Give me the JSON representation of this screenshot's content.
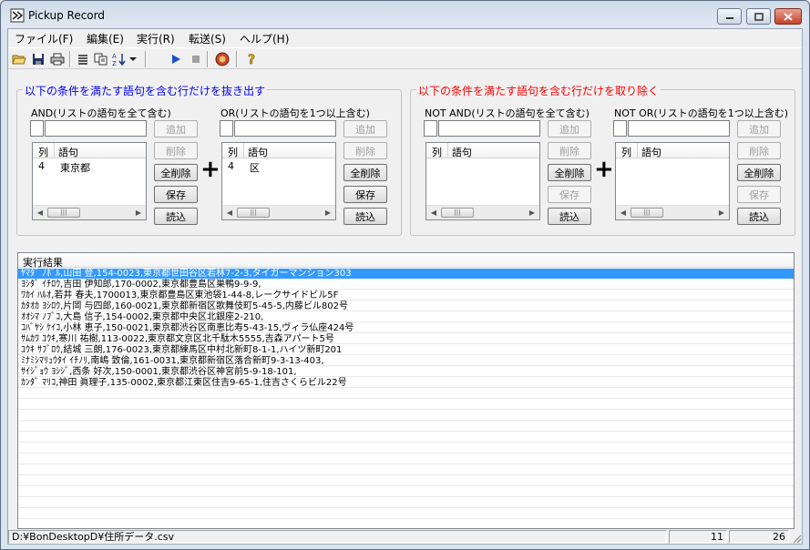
{
  "window": {
    "title": "Pickup Record"
  },
  "menu": [
    "ファイル(F)",
    "編集(E)",
    "実行(R)",
    "転送(S)",
    "ヘルプ(H)"
  ],
  "toolbar": {
    "icons": [
      "open-icon",
      "save-icon",
      "print-icon",
      "list-icon",
      "copy-icon",
      "sort-icon",
      "dropdown-icon",
      "run-icon",
      "stop-icon",
      "transfer-icon",
      "help-icon"
    ]
  },
  "extract_group": {
    "title": "以下の条件を満たす語句を含む行だけを抜き出す",
    "color": "#0000ff",
    "and_list": {
      "label": "AND(リストの語句を全て含む)",
      "column_headers": [
        "列",
        "語句"
      ],
      "rows": [
        {
          "col": "4",
          "term": "東京都"
        }
      ],
      "buttons": {
        "add": "追加",
        "delete": "削除",
        "delete_all": "全削除",
        "save": "保存",
        "load": "読込"
      }
    },
    "or_list": {
      "label": "OR(リストの語句を1つ以上含む)",
      "column_headers": [
        "列",
        "語句"
      ],
      "rows": [
        {
          "col": "4",
          "term": "区"
        }
      ],
      "buttons": {
        "add": "追加",
        "delete": "削除",
        "delete_all": "全削除",
        "save": "保存",
        "load": "読込"
      }
    },
    "plus": "+"
  },
  "exclude_group": {
    "title": "以下の条件を満たす語句を含む行だけを取り除く",
    "color": "#ff0000",
    "not_and_list": {
      "label": "NOT AND(リストの語句を全て含む)",
      "column_headers": [
        "列",
        "語句"
      ],
      "rows": [],
      "buttons": {
        "add": "追加",
        "delete": "削除",
        "delete_all": "全削除",
        "save": "保存",
        "load": "読込"
      }
    },
    "not_or_list": {
      "label": "NOT OR(リストの語句を1つ以上含む)",
      "column_headers": [
        "列",
        "語句"
      ],
      "rows": [],
      "buttons": {
        "add": "追加",
        "delete": "削除",
        "delete_all": "全削除",
        "save": "保存",
        "load": "読込"
      }
    },
    "plus": "+"
  },
  "results": {
    "header": "実行結果",
    "rows": [
      "ﾔﾏﾀﾞ ﾉﾎﾞﾙ,山田 登,154-0023,東京都世田谷区若林7-2-3,タイガーマンション303",
      "ﾖｼﾀﾞ ｲﾁﾛｳ,吉田 伊知郎,170-0002,東京都豊島区巣鴨9-9-9,",
      "ﾜｶｲ ﾊﾙｵ,若井 春夫,1700013,東京都豊島区東池袋1-44-8,レークサイドビル5F",
      "ｶﾀｵｶ ﾖｼﾛｳ,片岡 与四郎,160-0021,東京都新宿区歌舞伎町5-45-5,内藤ビル802号",
      "ｵｵｼﾏ ﾉﾌﾞｺ,大島 信子,154-0002,東京都中央区北銀座2-210,",
      "ｺﾊﾞﾔｼ ｹｲｺ,小林 恵子,150-0021,東京都渋谷区南恵比寿5-43-15,ヴィラ仏座424号",
      "ｻﾑｶﾜ ﾕｳｷ,寒川 祐樹,113-0022,東京都文京区北千駄木5555,吉森アパート5号",
      "ﾕｳｷ ｻﾌﾞﾛｳ,結城 三朗,176-0023,東京都練馬区中村北新町8-1-1,ハイツ新町201",
      "ﾐﾅﾐｼﾏﾘｭｳﾀｲ ｲﾁﾉﾘ,南嶋 致倫,161-0031,東京都新宿区落合新町9-3-13-403,",
      "ｻｲｼﾞｮｳ ﾖｼｼﾞ,西条 好次,150-0001,東京都渋谷区神宮前5-9-18-101,",
      "ｶﾝﾀﾞ ﾏﾘｺ,神田 眞理子,135-0002,東京都江東区住吉9-65-1,住吉さくらビル22号"
    ],
    "selected_index": 0,
    "selection_color": "#3399ff"
  },
  "status": {
    "file_path": "D:¥BonDesktopD¥住所データ.csv",
    "count_a": "11",
    "count_b": "26"
  }
}
